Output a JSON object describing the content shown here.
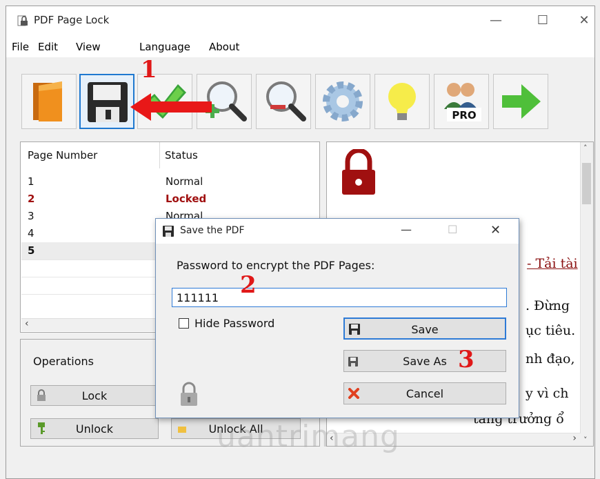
{
  "window": {
    "title": "PDF Page Lock"
  },
  "menu": [
    "File",
    "Edit",
    "View",
    "Language",
    "About"
  ],
  "toolbar": {
    "buttons": [
      "folder-icon",
      "floppy-save-icon",
      "checkmark-icon",
      "zoom-in-icon",
      "zoom-out-icon",
      "gear-icon",
      "lightbulb-icon",
      "pro-users-icon",
      "next-arrow-icon"
    ],
    "pro_badge": "PRO"
  },
  "pages": {
    "headers": {
      "page": "Page Number",
      "status": "Status"
    },
    "rows": [
      {
        "page": "1",
        "status": "Normal"
      },
      {
        "page": "2",
        "status": "Locked"
      },
      {
        "page": "3",
        "status": "Normal"
      },
      {
        "page": "4",
        "status": ""
      },
      {
        "page": "5",
        "status": ""
      }
    ]
  },
  "operations": {
    "title": "Operations",
    "lock": "Lock",
    "unlock": "Unlock",
    "unlock_all": "Unlock All"
  },
  "preview": {
    "lines": [
      "- Tải tài",
      ". Đừng",
      "ục tiêu.",
      "nh đạo,",
      "y vì ch",
      "tăng trưởng ổ"
    ]
  },
  "dialog": {
    "title": "Save the PDF",
    "prompt": "Password to encrypt the PDF Pages:",
    "password": "111111",
    "hide_password": "Hide Password",
    "save": "Save",
    "save_as": "Save As",
    "cancel": "Cancel"
  },
  "annotations": [
    "1",
    "2",
    "3"
  ],
  "watermark": "uantrimang",
  "colors": {
    "locked": "#a01010",
    "accent": "#2d7ad6",
    "annotation": "#e01818"
  }
}
